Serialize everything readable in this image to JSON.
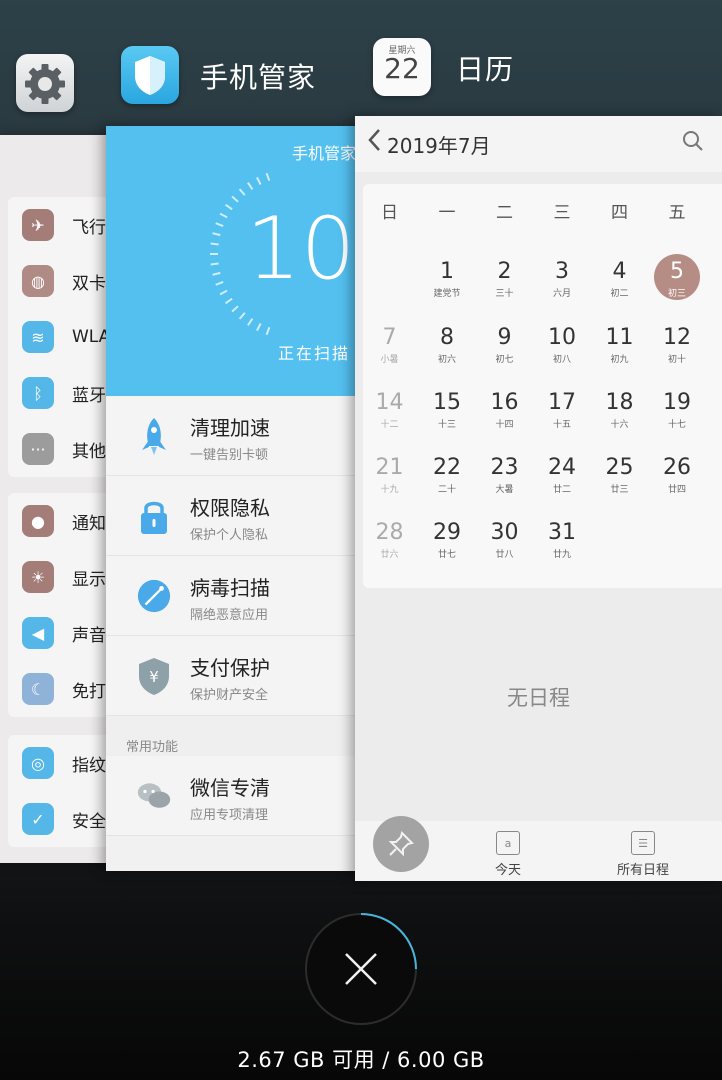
{
  "apps": {
    "guard_title": "手机管家",
    "calendar_title": "日历",
    "calendar_icon_weekday": "星期六",
    "calendar_icon_day": "22"
  },
  "settings": {
    "items": [
      {
        "label": "飞行",
        "icon": "airplane-icon",
        "color": "#a47d78"
      },
      {
        "label": "双卡",
        "icon": "globe-icon",
        "color": "#b08a85"
      },
      {
        "label": "WLA",
        "icon": "wifi-icon",
        "color": "#55b6e8"
      },
      {
        "label": "蓝牙",
        "icon": "bluetooth-icon",
        "color": "#55b6e8"
      },
      {
        "label": "其他",
        "icon": "more-icon",
        "color": "#9c9c9c"
      },
      {
        "label": "通知",
        "icon": "notification-icon",
        "color": "#a47d78"
      },
      {
        "label": "显示",
        "icon": "display-icon",
        "color": "#a47d78"
      },
      {
        "label": "声音",
        "icon": "speaker-icon",
        "color": "#55b6e8"
      },
      {
        "label": "免打",
        "icon": "moon-icon",
        "color": "#8fb2d9"
      },
      {
        "label": "指纹",
        "icon": "fingerprint-icon",
        "color": "#55b6e8"
      },
      {
        "label": "安全",
        "icon": "shield-icon",
        "color": "#55b6e8"
      }
    ]
  },
  "guard": {
    "header": "手机管家",
    "score": "10",
    "scanning": "正在扫描",
    "features": [
      {
        "title": "清理加速",
        "sub": "一键告别卡顿",
        "icon": "rocket-icon"
      },
      {
        "title": "权限隐私",
        "sub": "保护个人隐私",
        "icon": "lock-icon"
      },
      {
        "title": "病毒扫描",
        "sub": "隔绝恶意应用",
        "icon": "radar-icon"
      },
      {
        "title": "支付保护",
        "sub": "保护财产安全",
        "icon": "payment-shield-icon"
      }
    ],
    "section": "常用功能",
    "common": [
      {
        "title": "微信专清",
        "sub": "应用专项清理",
        "icon": "wechat-icon"
      }
    ]
  },
  "calendar": {
    "month": "2019年7月",
    "weekdays": [
      "日",
      "一",
      "二",
      "三",
      "四",
      "五"
    ],
    "days": [
      {
        "n": "1",
        "l": "建党节"
      },
      {
        "n": "2",
        "l": "三十"
      },
      {
        "n": "3",
        "l": "六月"
      },
      {
        "n": "4",
        "l": "初二"
      },
      {
        "n": "5",
        "l": "初三"
      },
      {
        "n": "7",
        "l": "小暑"
      },
      {
        "n": "8",
        "l": "初六"
      },
      {
        "n": "9",
        "l": "初七"
      },
      {
        "n": "10",
        "l": "初八"
      },
      {
        "n": "11",
        "l": "初九"
      },
      {
        "n": "12",
        "l": "初十"
      },
      {
        "n": "14",
        "l": "十二"
      },
      {
        "n": "15",
        "l": "十三"
      },
      {
        "n": "16",
        "l": "十四"
      },
      {
        "n": "17",
        "l": "十五"
      },
      {
        "n": "18",
        "l": "十六"
      },
      {
        "n": "19",
        "l": "十七"
      },
      {
        "n": "21",
        "l": "十九"
      },
      {
        "n": "22",
        "l": "二十"
      },
      {
        "n": "23",
        "l": "大暑"
      },
      {
        "n": "24",
        "l": "廿二"
      },
      {
        "n": "25",
        "l": "廿三"
      },
      {
        "n": "26",
        "l": "廿四"
      },
      {
        "n": "28",
        "l": "廿六"
      },
      {
        "n": "29",
        "l": "廿七"
      },
      {
        "n": "30",
        "l": "廿八"
      },
      {
        "n": "31",
        "l": "廿九"
      }
    ],
    "empty": "无日程",
    "today_label": "今天",
    "all_label": "所有日程"
  },
  "memory": "2.67 GB 可用 / 6.00 GB"
}
